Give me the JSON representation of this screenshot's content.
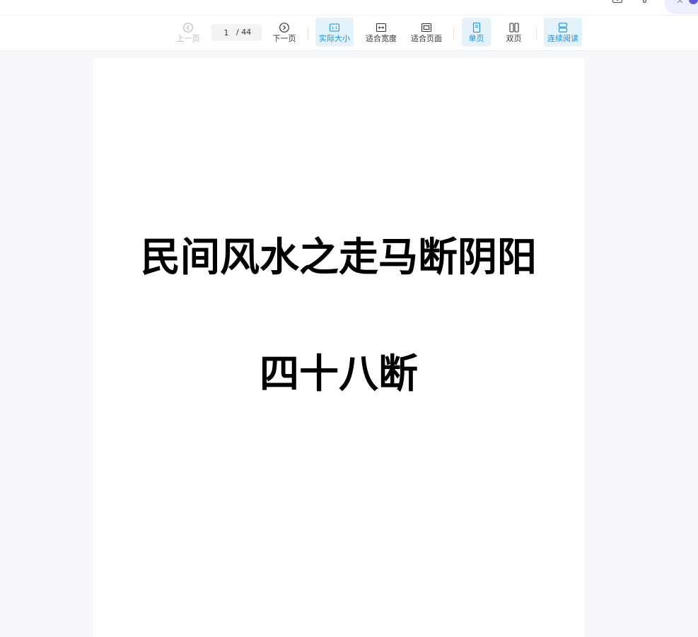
{
  "header": {
    "icons": [
      "screen-icon",
      "share-icon"
    ],
    "assistant": {
      "close_icon": "close-icon",
      "avatar": "assistant-avatar"
    }
  },
  "toolbar": {
    "prev_page": {
      "label": "上一页",
      "icon": "chevron-left-circle-icon",
      "disabled": true
    },
    "page_indicator": {
      "current": "1",
      "total": "/ 44"
    },
    "next_page": {
      "label": "下一页",
      "icon": "chevron-right-circle-icon",
      "disabled": false
    },
    "zoom_modes": [
      {
        "label": "实际大小",
        "icon": "actual-size-icon",
        "icon_text": "1:1",
        "active": true
      },
      {
        "label": "适合宽度",
        "icon": "fit-width-icon",
        "active": false
      },
      {
        "label": "适合页面",
        "icon": "fit-page-icon",
        "active": false
      }
    ],
    "page_modes": [
      {
        "label": "单页",
        "icon": "single-page-icon",
        "active": true
      },
      {
        "label": "双页",
        "icon": "double-page-icon",
        "active": false
      }
    ],
    "scroll_modes": [
      {
        "label": "连续阅读",
        "icon": "continuous-scroll-icon",
        "active": true
      }
    ]
  },
  "document": {
    "title_lines": [
      "民间风水之走马断阴阳",
      "四十八断"
    ]
  },
  "colors": {
    "accent": "#1b8fd8",
    "active_bg": "#e3f2fb",
    "viewer_bg": "#f5f7fa",
    "disabled": "#b8bcc4"
  }
}
